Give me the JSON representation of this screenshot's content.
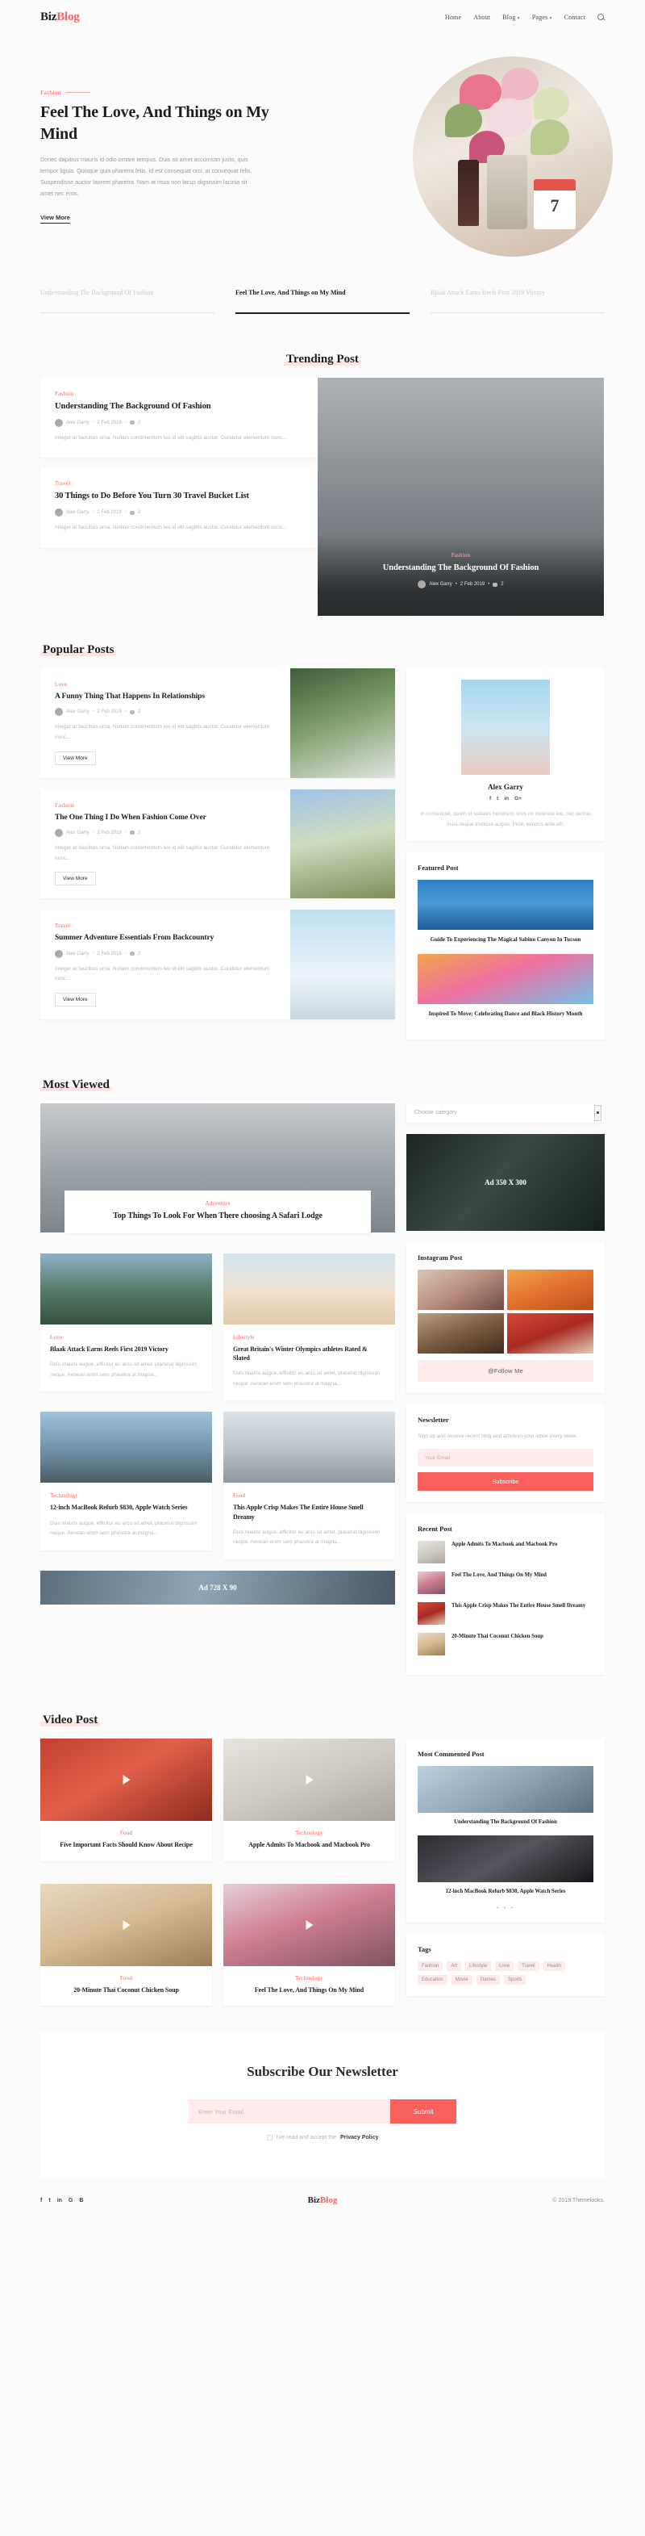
{
  "brand": {
    "part1": "Biz",
    "part2": "Blog"
  },
  "colors": {
    "accent": "#f4645f",
    "accent_soft": "#fdeceb",
    "ink": "#1d1d1d",
    "muted": "#b8b8b8"
  },
  "nav": {
    "items": [
      {
        "label": "Home",
        "caret": false
      },
      {
        "label": "About",
        "caret": false
      },
      {
        "label": "Blog",
        "caret": true
      },
      {
        "label": "Pages",
        "caret": true
      },
      {
        "label": "Contact",
        "caret": false
      }
    ],
    "search_icon": "search-icon"
  },
  "hero": {
    "category": "Fashion",
    "title": "Feel The Love, And Things on My Mind",
    "text": "Donec dapibus mauris id odio ornare tempus. Duis sit amet accumsan justo, quis tempor ligula. Quisque quis pharetra felis, id est consequat orci, at consequat felis. Suspendisse auctor laoreet pharetra. Nam at risus non lacus dignissim lacinia sit amet nec eros.",
    "cta": "View More"
  },
  "slider_tabs": [
    {
      "label": "Understanding The Background Of Fashion",
      "active": false
    },
    {
      "label": "Feel The Love, And Things on My Mind",
      "active": true
    },
    {
      "label": "Blaak Attack Earns Reels First 2019 Victory",
      "active": false
    }
  ],
  "trending": {
    "heading": "Trending Post",
    "cards": [
      {
        "category": "Fashion",
        "title": "Understanding The Background Of Fashion",
        "author": "Alex Garry",
        "date": "2 Feb 2019",
        "comments": "2",
        "excerpt": "Integer at faucibus urna. Nullam condimentum leo id elit sagittis auctor. Curabitur elementum nunc..."
      },
      {
        "category": "Travel",
        "title": "30 Things to Do Before You Turn 30 Travel Bucket List",
        "author": "Alex Garry",
        "date": "2 Feb 2019",
        "comments": "2",
        "excerpt": "Integer at faucibus urna. Nullam condimentum leo id elit sagittis auctor. Curabitur elementum nunc..."
      }
    ],
    "feature": {
      "category": "Fashion",
      "title": "Understanding The Background Of Fashion",
      "author": "Alex Garry",
      "date": "2 Feb 2019",
      "comments": "2"
    }
  },
  "popular": {
    "heading": "Popular Posts",
    "posts": [
      {
        "category": "Love",
        "title": "A Funny Thing That Happens In Relationships",
        "author": "Alex Garry",
        "date": "2 Feb 2019",
        "comments": "2",
        "excerpt": "Integer at faucibus urna. Nullam condimentum leo id elit sagittis auctor. Curabitur elementum nunc...",
        "cta": "View More",
        "thumb": "ph-forest"
      },
      {
        "category": "Fashion",
        "title": "The One Thing I Do When Fashion Come Over",
        "author": "Alex Garry",
        "date": "2 Feb 2019",
        "comments": "2",
        "excerpt": "Integer at faucibus urna. Nullam condimentum leo id elit sagittis auctor. Curabitur elementum nunc...",
        "cta": "View More",
        "thumb": "ph-field"
      },
      {
        "category": "Travel",
        "title": "Summer Adventure Essentials From Backcountry",
        "author": "Alex Garry",
        "date": "2 Feb 2019",
        "comments": "2",
        "excerpt": "Integer at faucibus urna. Nullam condimentum leo id elit sagittis auctor. Curabitur elementum nunc...",
        "cta": "View More",
        "thumb": "ph-sky"
      }
    ]
  },
  "author_widget": {
    "name": "Alex Garry",
    "socials": [
      "f",
      "t",
      "in",
      "G+"
    ],
    "bio": "In consequat, quam id sodales hendrerit, eros mi molestie leo, nec lacinia risus neque tristique augue. Proin tempus ante elit."
  },
  "featured_widget": {
    "title": "Featured Post",
    "items": [
      {
        "caption": "Guide To Experiencing The Magical Sabino Canyon In Tucson",
        "img": "ph-santo"
      },
      {
        "caption": "Inspired To Move: Celebrating Dance and Black History Month",
        "img": "ph-carn"
      }
    ]
  },
  "most_viewed": {
    "heading": "Most Viewed",
    "hero": {
      "category": "Adventure",
      "title": "Top Things To Look For When There choosing A Safari Lodge",
      "img": "ph-cliff"
    },
    "cells": [
      {
        "category": "Love",
        "title": "Blaak Attack Earns Reels First 2019 Victory",
        "excerpt": "Duis mauris augue, efficitur eu arcu sit amet, placerat dignissim neque. Aenean enim sem pharetra at magna...",
        "img": "ph-lake"
      },
      {
        "category": "Lifestyle",
        "title": "Great Britain's Winter Olympics athletes Rated & Slated",
        "excerpt": "Duis mauris augue, efficitur eu arcu sit amet, placerat dignissim neque. Aenean enim sem pharetra at magna...",
        "img": "ph-beach"
      },
      {
        "category": "Technology",
        "title": "12-inch MacBook Refurb $830, Apple Watch Series",
        "excerpt": "Duis mauris augue, efficitur eu arcu sit amet, placerat dignissim neque. Aenean enim sem pharetra at magna...",
        "img": "ph-mount"
      },
      {
        "category": "Food",
        "title": "This Apple Crisp Makes The Entire House Smell Dreamy",
        "excerpt": "Duis mauris augue, efficitur eu arcu sit amet, placerat dignissim neque. Aenean enim sem pharetra at magna...",
        "img": "ph-snow"
      }
    ],
    "ad_banner": "Ad 728 X 90"
  },
  "sidebar2": {
    "category_select": "Choose category",
    "ad": "Ad 350 X 300",
    "instagram": {
      "title": "Instagram Post",
      "cells": [
        "ph-wine",
        "ph-juice",
        "ph-choc",
        "ph-berry"
      ],
      "follow": "@Follow Me"
    },
    "newsletter": {
      "title": "Newsletter",
      "desc": "Sign up and receive recent blog and article in your inbox every week.",
      "placeholder": "Your Email",
      "button": "Subscribe"
    },
    "recent": {
      "title": "Recent Post",
      "items": [
        {
          "title": "Apple Admits To Macbook and Macbook Pro",
          "thumb": "ph-desk"
        },
        {
          "title": "Feel The Love, And Things On My Mind",
          "thumb": "ph-flwr"
        },
        {
          "title": "This Apple Crisp Makes The Entire House Smell Dreamy",
          "thumb": "ph-berry"
        },
        {
          "title": "20-Minute Thai Coconut Chicken Soup",
          "thumb": "ph-soup"
        }
      ]
    }
  },
  "video": {
    "heading": "Video Post",
    "cells": [
      {
        "category": "Food",
        "title": "Five Important Facts Should Know About Recipe",
        "img": "ph-toma"
      },
      {
        "category": "Technology",
        "title": "Apple Admits To Macbook and Macbook Pro",
        "img": "ph-desk"
      },
      {
        "category": "Food",
        "title": "20-Minute Thai Coconut Chicken Soup",
        "img": "ph-soup"
      },
      {
        "category": "Technology",
        "title": "Feel The Love, And Things On My Mind",
        "img": "ph-flwr"
      }
    ]
  },
  "sidebar3": {
    "most_commented": {
      "title": "Most Commented Post",
      "items": [
        {
          "caption": "Understanding The Background Of Fashion",
          "img": "ph-model"
        },
        {
          "caption": "12-inch MacBook Refurb $830, Apple Watch Series",
          "img": "ph-hand"
        }
      ],
      "dots": "• • •"
    },
    "tags": {
      "title": "Tags",
      "items": [
        "Fashion",
        "Art",
        "Lifestyle",
        "Love",
        "Travel",
        "Health",
        "Education",
        "Movie",
        "Games",
        "Sports"
      ]
    }
  },
  "subscribe": {
    "title": "Subscribe Our Newsletter",
    "placeholder": "Enter Your Email",
    "button": "Submit",
    "note_pre": "I've read and accept the",
    "note_link": "Privacy Policy"
  },
  "footer": {
    "socials": [
      "f",
      "t",
      "in",
      "G",
      "B"
    ],
    "copyright": "© 2019 Themelooks."
  }
}
